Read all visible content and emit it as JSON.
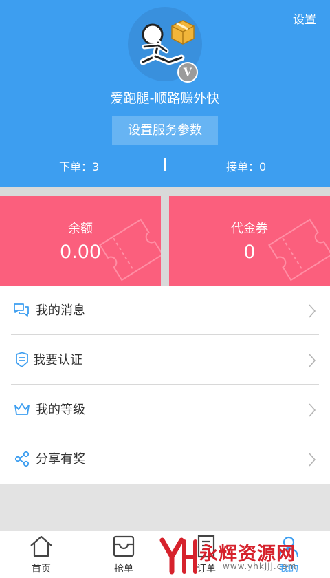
{
  "header": {
    "settings_label": "设置",
    "username": "爱跑腿-顺路赚外快",
    "service_button": "设置服务参数",
    "badge_letter": "V",
    "stats": {
      "orders_placed": "下单：3",
      "orders_taken": "接单：0"
    }
  },
  "cards": {
    "balance": {
      "label": "余额",
      "value": "0.00"
    },
    "voucher": {
      "label": "代金券",
      "value": "0"
    }
  },
  "menu": {
    "items": [
      {
        "label": "我的消息",
        "icon": "chat-bubbles-icon"
      },
      {
        "label": "我要认证",
        "icon": "id-badge-icon"
      },
      {
        "label": "我的等级",
        "icon": "crown-icon"
      },
      {
        "label": "分享有奖",
        "icon": "share-icon"
      }
    ]
  },
  "tabbar": {
    "tabs": [
      {
        "label": "首页",
        "icon": "home-icon"
      },
      {
        "label": "抢单",
        "icon": "inbox-icon"
      },
      {
        "label": "订单",
        "icon": "document-icon"
      },
      {
        "label": "我的",
        "icon": "profile-icon",
        "active": true
      }
    ]
  },
  "watermark": {
    "text": "永辉资源网",
    "url": "www.yhkjjj.com"
  },
  "colors": {
    "header_blue": "#3d9ef0",
    "card_pink": "#fb5f7d",
    "icon_blue": "#3d9ef0"
  }
}
